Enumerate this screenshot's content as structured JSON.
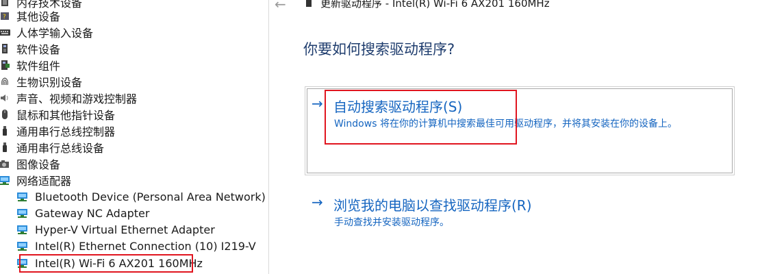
{
  "device_tree": {
    "categories": [
      {
        "label": "内存技术设备",
        "icon": "memory-chip-icon"
      },
      {
        "label": "其他设备",
        "icon": "unknown-device-icon"
      },
      {
        "label": "人体学输入设备",
        "icon": "keyboard-icon"
      },
      {
        "label": "软件设备",
        "icon": "software-device-icon"
      },
      {
        "label": "软件组件",
        "icon": "software-component-icon"
      },
      {
        "label": "生物识别设备",
        "icon": "fingerprint-icon"
      },
      {
        "label": "声音、视频和游戏控制器",
        "icon": "speaker-icon"
      },
      {
        "label": "鼠标和其他指针设备",
        "icon": "mouse-icon"
      },
      {
        "label": "通用串行总线控制器",
        "icon": "usb-icon"
      },
      {
        "label": "通用串行总线设备",
        "icon": "usb-icon"
      },
      {
        "label": "图像设备",
        "icon": "camera-icon"
      },
      {
        "label": "网络适配器",
        "icon": "network-adapter-icon"
      }
    ],
    "network_adapters": [
      {
        "label": "Bluetooth Device (Personal Area Network)",
        "icon": "network-adapter-icon"
      },
      {
        "label": "Gateway NC Adapter",
        "icon": "network-adapter-icon"
      },
      {
        "label": "Hyper-V Virtual Ethernet Adapter",
        "icon": "network-adapter-icon"
      },
      {
        "label": "Intel(R) Ethernet Connection (10) I219-V",
        "icon": "network-adapter-icon"
      },
      {
        "label": "Intel(R) Wi-Fi 6 AX201 160MHz",
        "icon": "network-adapter-icon"
      }
    ]
  },
  "wizard": {
    "back_icon": "back-arrow-icon",
    "title": "更新驱动程序 - Intel(R) Wi-Fi 6 AX201 160MHz",
    "question": "你要如何搜索驱动程序?",
    "options": [
      {
        "arrow": "→",
        "title": "自动搜索驱动程序(S)",
        "description": "Windows 将在你的计算机中搜索最佳可用驱动程序，并将其安装在你的设备上。"
      },
      {
        "arrow": "→",
        "title": "浏览我的电脑以查找驱动程序(R)",
        "description": "手动查找并安装驱动程序。"
      }
    ]
  },
  "colors": {
    "link_blue": "#1565c0",
    "heading_blue": "#1f3d6e",
    "highlight_red": "#e0141e"
  }
}
